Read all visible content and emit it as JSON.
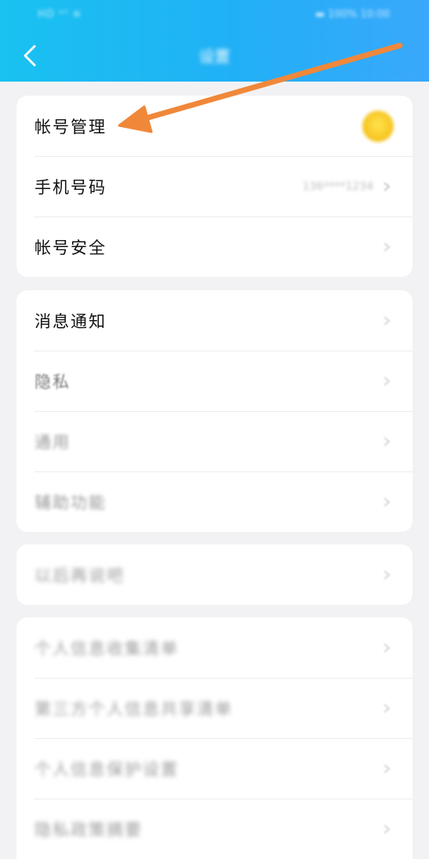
{
  "status_bar": {
    "left": "HD ᵃˡˡ ≋",
    "right": "▬ 100% 10:00"
  },
  "header": {
    "title": "设置",
    "back_icon": "chevron-left-icon"
  },
  "cards": [
    {
      "rows": [
        {
          "label": "帐号管理",
          "trailing": "avatar"
        },
        {
          "label": "手机号码",
          "value": "136****1234"
        },
        {
          "label": "帐号安全"
        }
      ]
    },
    {
      "rows": [
        {
          "label": "消息通知"
        },
        {
          "label": "隐私"
        },
        {
          "label": "通用"
        },
        {
          "label": "辅助功能"
        }
      ]
    },
    {
      "rows": [
        {
          "label": "以后再说吧"
        }
      ]
    },
    {
      "rows": [
        {
          "label": "个人信息收集清单"
        },
        {
          "label": "第三方个人信息共享清单"
        },
        {
          "label": "个人信息保护设置"
        },
        {
          "label": "隐私政策摘要"
        }
      ]
    }
  ],
  "annotation": {
    "arrow_color": "#f0883a",
    "points_to": "帐号管理"
  },
  "colors": {
    "header_start": "#19c2f0",
    "header_end": "#3aa8fb",
    "page_bg": "#f2f2f4",
    "card_bg": "#ffffff"
  }
}
